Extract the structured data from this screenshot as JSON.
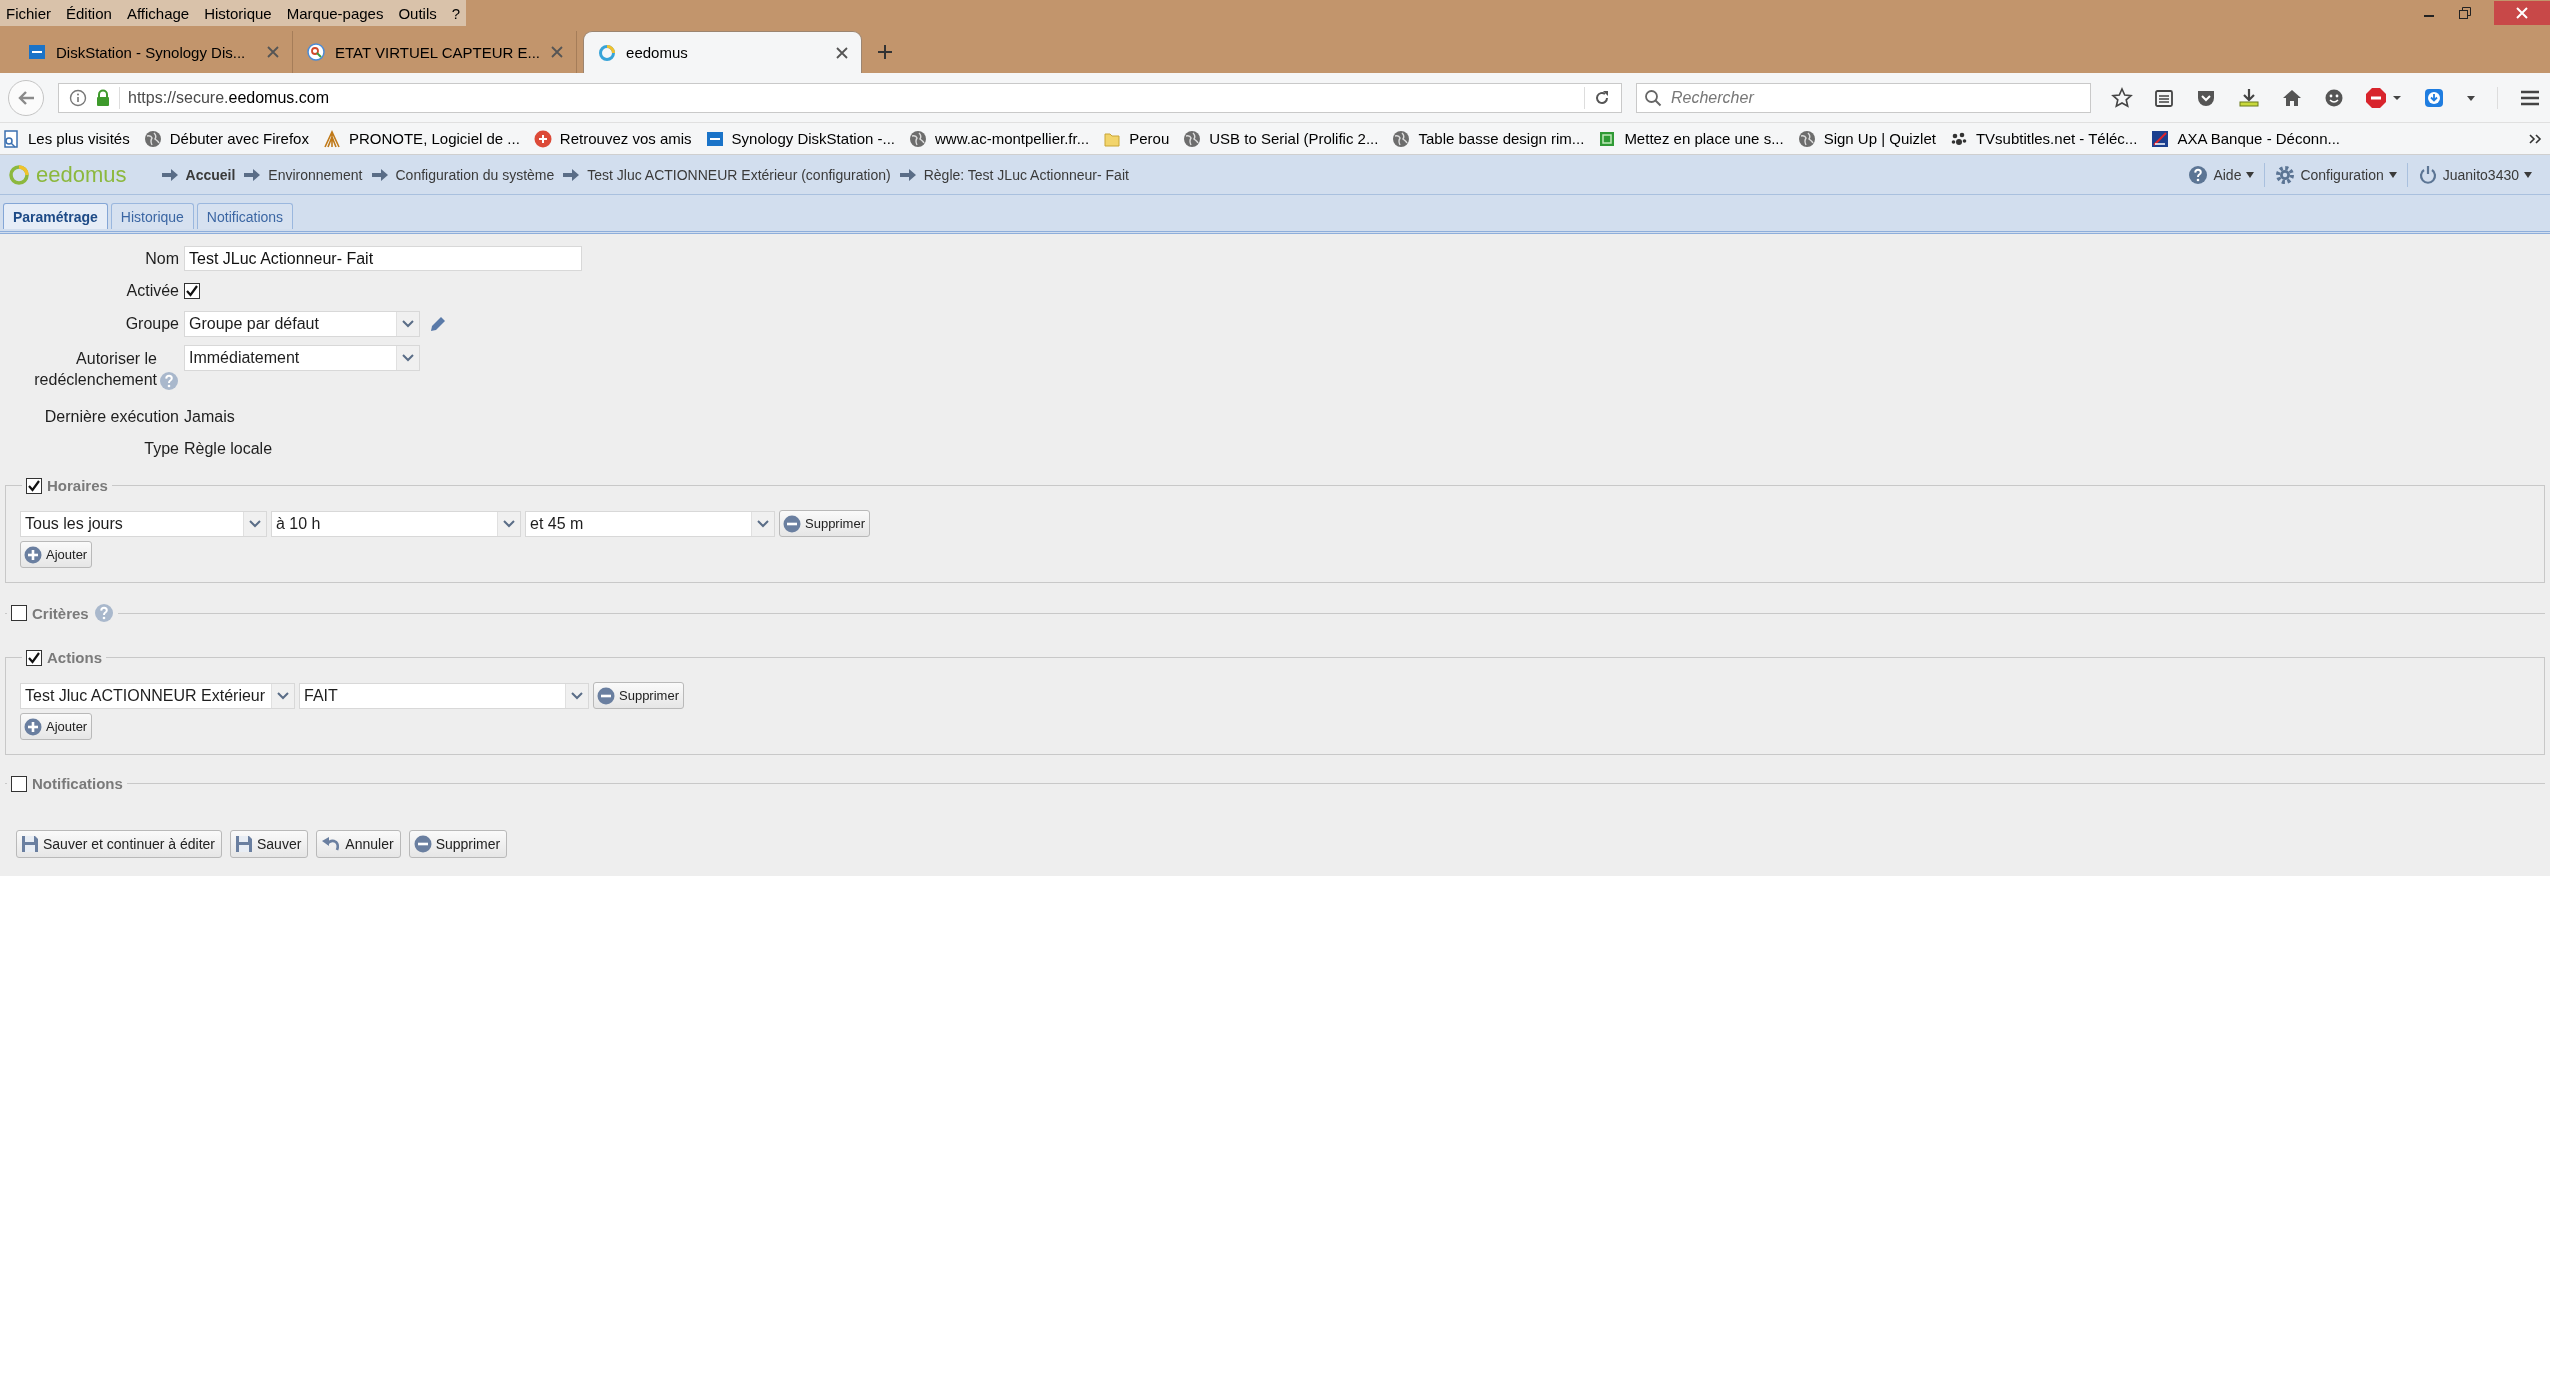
{
  "menu": [
    "Fichier",
    "Édition",
    "Affichage",
    "Historique",
    "Marque-pages",
    "Outils",
    "?"
  ],
  "browser_tabs": [
    {
      "title": "DiskStation - Synology Dis...",
      "kind": "dsm",
      "selected": false
    },
    {
      "title": "ETAT VIRTUEL CAPTEUR E...",
      "kind": "search",
      "selected": false
    },
    {
      "title": "eedomus",
      "kind": "ring",
      "selected": true
    }
  ],
  "address": {
    "url": "https://secure.**eedomus.com**"
  },
  "search": {
    "placeholder": "Rechercher"
  },
  "bookmarks": [
    {
      "label": "Les plus visités",
      "kind": "page"
    },
    {
      "label": "Débuter avec Firefox",
      "kind": "globe"
    },
    {
      "label": "PRONOTE, Logiciel de ...",
      "kind": "pronote"
    },
    {
      "label": "Retrouvez vos amis",
      "kind": "gplus"
    },
    {
      "label": "Synology DiskStation -...",
      "kind": "dsm"
    },
    {
      "label": "www.ac-montpellier.fr...",
      "kind": "globe"
    },
    {
      "label": "Perou",
      "kind": "folder"
    },
    {
      "label": "USB to Serial (Prolific 2...",
      "kind": "globe"
    },
    {
      "label": "Table basse design rim...",
      "kind": "globe"
    },
    {
      "label": "Mettez en place une s...",
      "kind": "green"
    },
    {
      "label": "Sign Up | Quizlet",
      "kind": "globe"
    },
    {
      "label": "TVsubtitles.net - Téléc...",
      "kind": "paw"
    },
    {
      "label": "AXA Banque - Déconn...",
      "kind": "axa"
    }
  ],
  "app": {
    "logo": "eedomus",
    "breadcrumb": [
      "Accueil",
      "Environnement",
      "Configuration du système",
      "Test Jluc ACTIONNEUR Extérieur (configuration)",
      "Règle: Test JLuc Actionneur- Fait"
    ],
    "menus": [
      {
        "label": "Aide",
        "kind": "help"
      },
      {
        "label": "Configuration",
        "kind": "gear"
      },
      {
        "label": "Juanito3430",
        "kind": "power"
      }
    ]
  },
  "page_tabs": [
    {
      "label": "Paramétrage",
      "selected": true
    },
    {
      "label": "Historique",
      "selected": false
    },
    {
      "label": "Notifications",
      "selected": false
    }
  ],
  "form": {
    "fields": [
      {
        "label": "Nom",
        "kind": "text",
        "value": "Test JLuc Actionneur- Fait"
      },
      {
        "label": "Activée",
        "kind": "checkbox",
        "checked": true
      },
      {
        "label": "Groupe",
        "kind": "select-edit",
        "value": "Groupe par défaut"
      },
      {
        "label": "Autoriser le redéclenchement",
        "kind": "select-help",
        "value": "Immédiatement"
      },
      {
        "label": "Dernière exécution",
        "kind": "static",
        "value": "Jamais"
      },
      {
        "label": "Type",
        "kind": "static",
        "value": "Règle locale"
      }
    ],
    "sections": [
      {
        "title": "Horaires",
        "checked": true,
        "rows": [
          {
            "selects": [
              "Tous les jours",
              "à 10 h",
              "et 45 m"
            ],
            "remove": "Supprimer"
          }
        ],
        "add": "Ajouter"
      },
      {
        "title": "Critères",
        "checked": false,
        "help": true
      },
      {
        "title": "Actions",
        "checked": true,
        "rows": [
          {
            "selects": [
              "Test Jluc ACTIONNEUR Extérieur",
              "FAIT"
            ],
            "remove": "Supprimer"
          }
        ],
        "add": "Ajouter"
      },
      {
        "title": "Notifications",
        "checked": false
      }
    ],
    "buttons": [
      {
        "label": "Sauver et continuer à éditer",
        "kind": "save"
      },
      {
        "label": "Sauver",
        "kind": "save"
      },
      {
        "label": "Annuler",
        "kind": "undo"
      },
      {
        "label": "Supprimer",
        "kind": "delete"
      }
    ]
  }
}
